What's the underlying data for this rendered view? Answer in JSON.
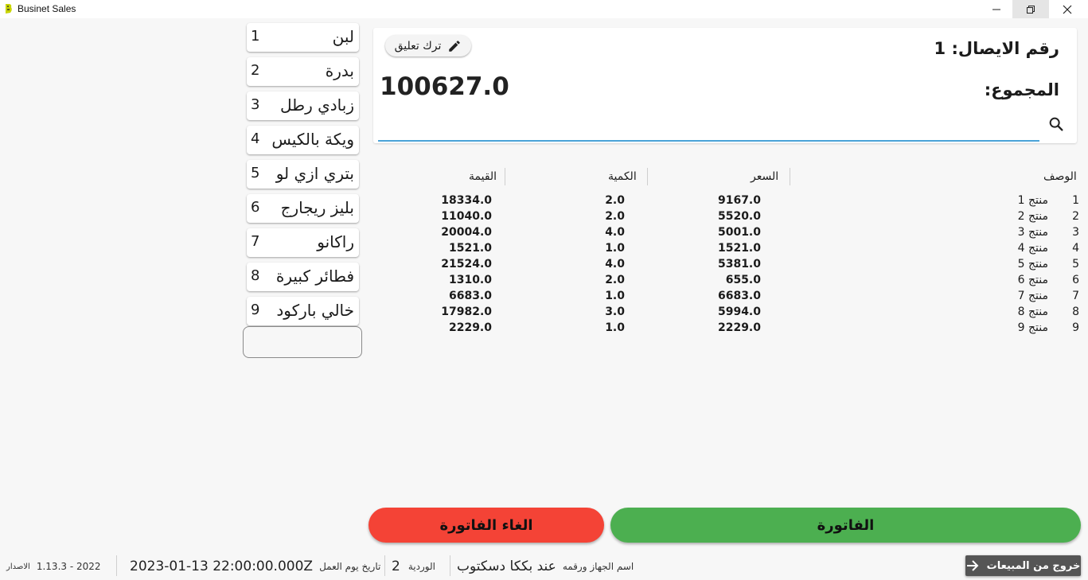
{
  "window": {
    "title": "Businet Sales"
  },
  "products": [
    {
      "name": "لبن",
      "num": "1"
    },
    {
      "name": "بدرة",
      "num": "2"
    },
    {
      "name": "زبادي رطل",
      "num": "3"
    },
    {
      "name": "ويكة بالكيس",
      "num": "4"
    },
    {
      "name": "بتري ازي لو",
      "num": "5"
    },
    {
      "name": "بليز ريجارج",
      "num": "6"
    },
    {
      "name": "راكانو",
      "num": "7"
    },
    {
      "name": "فطائر كبيرة",
      "num": "8"
    },
    {
      "name": "خالي باركود",
      "num": "9"
    }
  ],
  "header": {
    "receipt": "رقم الايصال: 1",
    "total_label": "المجموع:",
    "total_value": "100627.0",
    "comment_button": "ترك تعليق"
  },
  "search": {
    "value": ""
  },
  "table": {
    "headers": {
      "description": "الوصف",
      "price": "السعر",
      "quantity": "الكمية",
      "value": "القيمة"
    },
    "rows": [
      {
        "idx": "1",
        "desc": "منتج 1",
        "price": "9167.0",
        "qty": "2.0",
        "value": "18334.0"
      },
      {
        "idx": "2",
        "desc": "منتج 2",
        "price": "5520.0",
        "qty": "2.0",
        "value": "11040.0"
      },
      {
        "idx": "3",
        "desc": "منتج 3",
        "price": "5001.0",
        "qty": "4.0",
        "value": "20004.0"
      },
      {
        "idx": "4",
        "desc": "منتج 4",
        "price": "1521.0",
        "qty": "1.0",
        "value": "1521.0"
      },
      {
        "idx": "5",
        "desc": "منتج 5",
        "price": "5381.0",
        "qty": "4.0",
        "value": "21524.0"
      },
      {
        "idx": "6",
        "desc": "منتج 6",
        "price": "655.0",
        "qty": "2.0",
        "value": "1310.0"
      },
      {
        "idx": "7",
        "desc": "منتج 7",
        "price": "6683.0",
        "qty": "1.0",
        "value": "6683.0"
      },
      {
        "idx": "8",
        "desc": "منتج 8",
        "price": "5994.0",
        "qty": "3.0",
        "value": "17982.0"
      },
      {
        "idx": "9",
        "desc": "منتج 9",
        "price": "2229.0",
        "qty": "1.0",
        "value": "2229.0"
      }
    ]
  },
  "actions": {
    "invoice": "الفاتورة",
    "cancel_invoice": "الغاء الفاتورة"
  },
  "status": {
    "version_label": "الاصدار",
    "version_value": "1.13.3 - 2022",
    "workday_label": "تاريخ يوم العمل",
    "workday_value": "2023-01-13 22:00:00.000Z",
    "shift_label": "الوردية",
    "shift_value": "2",
    "device_label": "اسم الجهاز ورقمه",
    "device_value": "عند بككا دسكتوب",
    "exit_button": "خروج من المبيعات"
  },
  "colors": {
    "invoice": "#4caf50",
    "cancel": "#f44336",
    "accent": "#4aa3d8",
    "exit": "#555555"
  },
  "icons": [
    "app-logo-icon",
    "minimize-icon",
    "restore-icon",
    "close-icon",
    "pencil-icon",
    "search-icon",
    "arrow-right-icon"
  ]
}
